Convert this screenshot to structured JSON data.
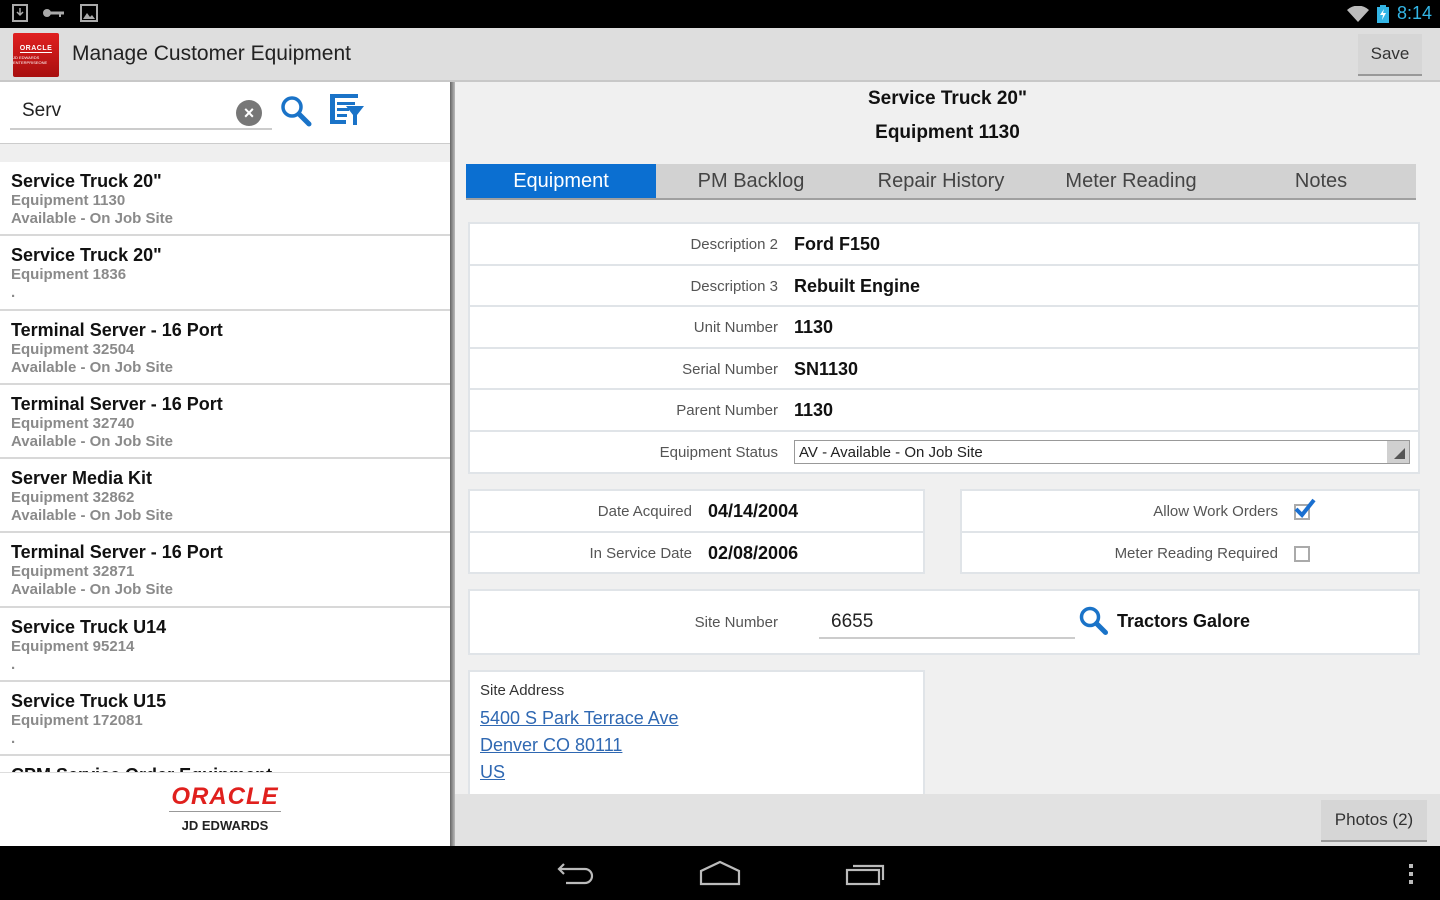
{
  "status_bar": {
    "time": "8:14",
    "left_icons": [
      "download-icon",
      "key-icon",
      "image-icon"
    ],
    "right_icons": [
      "wifi-icon",
      "battery-charging-icon"
    ]
  },
  "action_bar": {
    "logo_line1": "ORACLE",
    "logo_line2": "JD EDWARDS ENTERPRISEONE",
    "title": "Manage Customer Equipment",
    "save_label": "Save"
  },
  "search": {
    "value": "Serv",
    "placeholder": ""
  },
  "equipment_list": [
    {
      "title": "Service Truck 20\"",
      "equipment": "Equipment 1130",
      "status": "Available - On Job Site"
    },
    {
      "title": "Service Truck 20\"",
      "equipment": "Equipment 1836",
      "status": "."
    },
    {
      "title": "Terminal Server - 16 Port",
      "equipment": "Equipment 32504",
      "status": "Available - On Job Site"
    },
    {
      "title": "Terminal Server - 16 Port",
      "equipment": "Equipment 32740",
      "status": "Available - On Job Site"
    },
    {
      "title": "Server Media Kit",
      "equipment": "Equipment 32862",
      "status": "Available - On Job Site"
    },
    {
      "title": "Terminal Server - 16 Port",
      "equipment": "Equipment 32871",
      "status": "Available - On Job Site"
    },
    {
      "title": "Service Truck U14",
      "equipment": "Equipment 95214",
      "status": "."
    },
    {
      "title": "Service Truck U15",
      "equipment": "Equipment 172081",
      "status": "."
    },
    {
      "title": "CPM Service Order Equipment",
      "equipment": "",
      "status": ""
    }
  ],
  "footer_logo": {
    "brand": "ORACLE",
    "product": "JD EDWARDS"
  },
  "detail": {
    "title": "Service Truck 20\"",
    "subtitle": "Equipment 1130",
    "tabs": [
      {
        "label": "Equipment",
        "active": true
      },
      {
        "label": "PM Backlog",
        "active": false
      },
      {
        "label": "Repair History",
        "active": false
      },
      {
        "label": "Meter Reading",
        "active": false
      },
      {
        "label": "Notes",
        "active": false
      }
    ],
    "fields": [
      {
        "label": "Description 2",
        "value": "Ford F150"
      },
      {
        "label": "Description 3",
        "value": "Rebuilt Engine"
      },
      {
        "label": "Unit Number",
        "value": "1130"
      },
      {
        "label": "Serial Number",
        "value": "SN1130"
      },
      {
        "label": "Parent Number",
        "value": "1130"
      }
    ],
    "equipment_status": {
      "label": "Equipment Status",
      "value": "AV - Available - On Job Site"
    },
    "dates": [
      {
        "label": "Date Acquired",
        "value": "04/14/2004"
      },
      {
        "label": "In Service Date",
        "value": "02/08/2006"
      }
    ],
    "flags": [
      {
        "label": "Allow Work Orders",
        "checked": true
      },
      {
        "label": "Meter Reading Required",
        "checked": false
      }
    ],
    "site": {
      "label": "Site Number",
      "value": "6655",
      "name": "Tractors Galore"
    },
    "address": {
      "label": "Site Address",
      "lines": [
        "5400 S Park Terrace Ave",
        "Denver CO 80111",
        "US"
      ]
    },
    "photos_label": "Photos (2)"
  },
  "colors": {
    "accent": "#0b6fd1",
    "oracle_red": "#e0201d",
    "link": "#2f68b2",
    "clock": "#33b5e5"
  }
}
